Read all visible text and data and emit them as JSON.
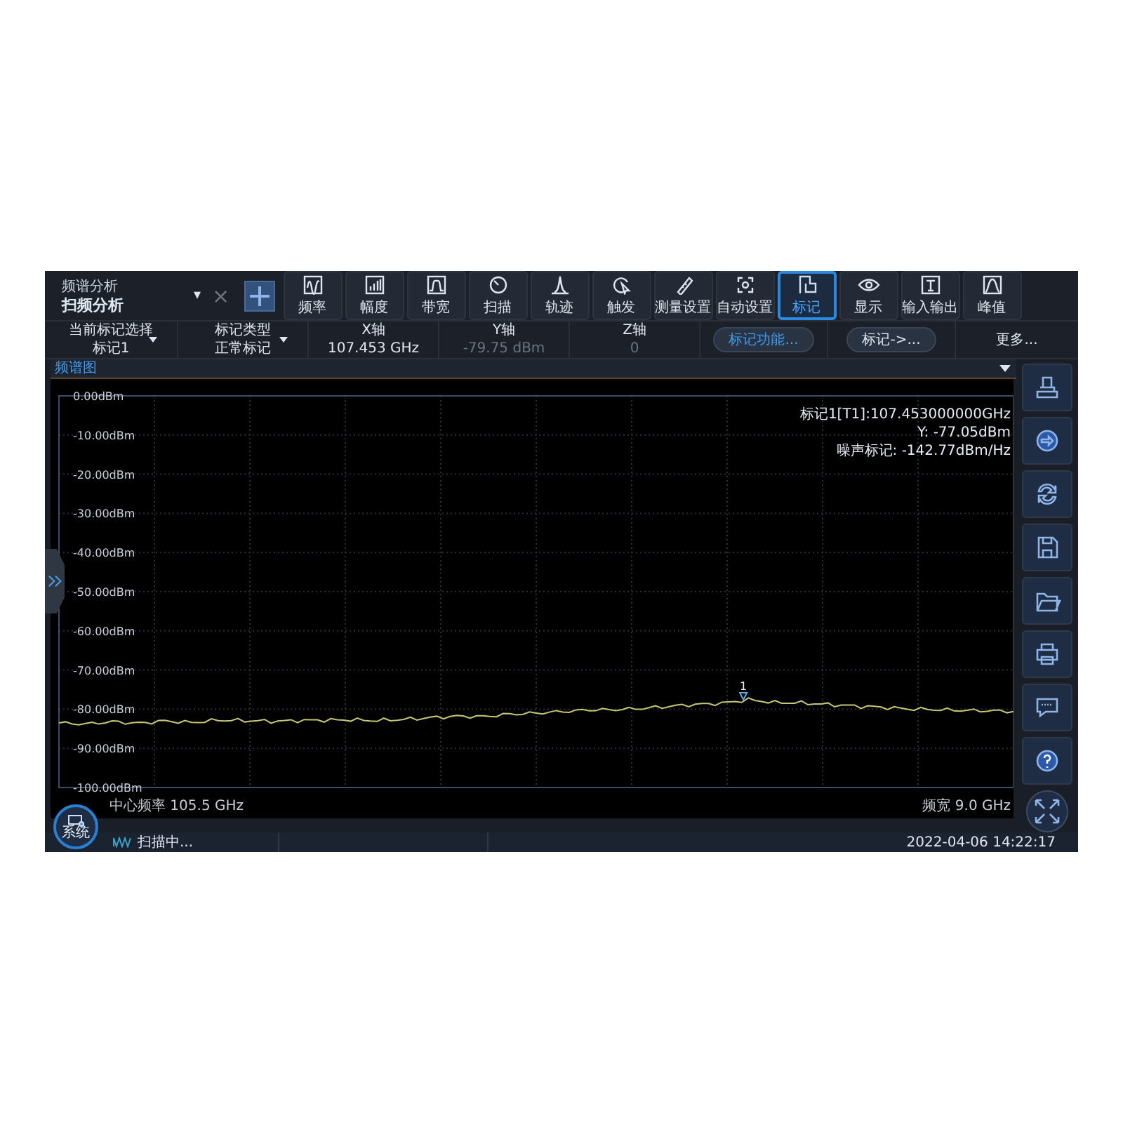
{
  "mode": {
    "caption": "频谱分析",
    "value": "扫频分析",
    "caret": "▾",
    "close": "×"
  },
  "toolbar": [
    {
      "label": "频率",
      "selected": false
    },
    {
      "label": "幅度",
      "selected": false
    },
    {
      "label": "带宽",
      "selected": false
    },
    {
      "label": "扫描",
      "selected": false
    },
    {
      "label": "轨迹",
      "selected": false
    },
    {
      "label": "触发",
      "selected": false
    },
    {
      "label": "测量设置",
      "selected": false
    },
    {
      "label": "自动设置",
      "selected": false
    },
    {
      "label": "标记",
      "selected": true
    },
    {
      "label": "显示",
      "selected": false
    },
    {
      "label": "输入输出",
      "selected": false
    },
    {
      "label": "峰值",
      "selected": false
    }
  ],
  "marker_bar": {
    "fields": [
      {
        "label": "当前标记选择",
        "value": "标记1",
        "dropdown": true,
        "disabled": false
      },
      {
        "label": "标记类型",
        "value": "正常标记",
        "dropdown": true,
        "disabled": false
      },
      {
        "label": "X轴",
        "value": "107.453 GHz",
        "dropdown": false,
        "disabled": false
      },
      {
        "label": "Y轴",
        "value": "-79.75 dBm",
        "dropdown": false,
        "disabled": true
      },
      {
        "label": "Z轴",
        "value": "0",
        "dropdown": false,
        "disabled": true
      }
    ],
    "buttons": [
      {
        "label": "标记功能...",
        "selected": true
      },
      {
        "label": "标记->...",
        "selected": false
      }
    ],
    "more": "更多..."
  },
  "panel": {
    "title": "频谱图",
    "readout": [
      "标记1[T1]:107.453000000GHz",
      "Y: -77.05dBm",
      "噪声标记: -142.77dBm/Hz"
    ],
    "center": "中心频率 105.5 GHz",
    "span": "频宽 9.0 GHz",
    "y_labels": [
      "0.00dBm",
      "-10.00dBm",
      "-20.00dBm",
      "-30.00dBm",
      "-40.00dBm",
      "-50.00dBm",
      "-60.00dBm",
      "-70.00dBm",
      "-80.00dBm",
      "-90.00dBm",
      "-100.00dBm"
    ],
    "marker": "1"
  },
  "status": {
    "system": "系统",
    "state": "扫描中...",
    "time": "2022-04-06 14:22:17"
  }
}
